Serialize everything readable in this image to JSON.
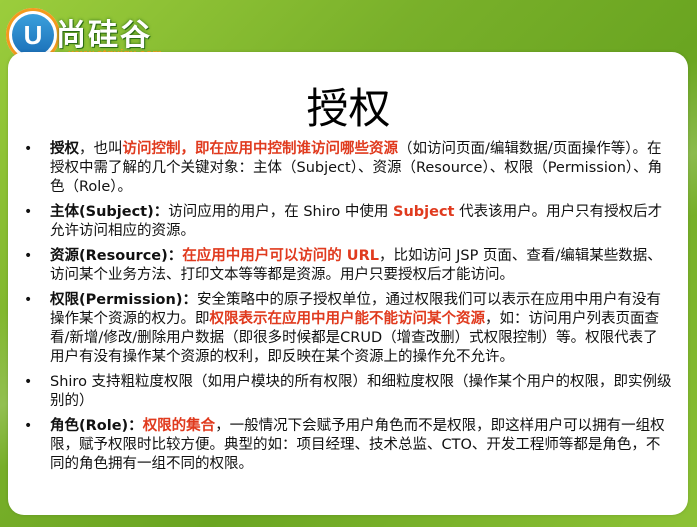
{
  "brand": {
    "name": "尚硅谷",
    "url": "www.atguigu.com",
    "badge_letter": "U"
  },
  "slide": {
    "title": "授权",
    "bullets": [
      [
        {
          "t": "授权",
          "s": "b"
        },
        {
          "t": "，也叫",
          "s": ""
        },
        {
          "t": "访问控制，即在应用中控制谁访问哪些资源",
          "s": "r"
        },
        {
          "t": "（如访问页面/编辑数据/页面操作等）。在授权中需了解的几个关键对象：主体（Subject）、资源（Resource）、权限（Permission）、角色（Role）。",
          "s": ""
        }
      ],
      [
        {
          "t": "主体(Subject)：",
          "s": "b"
        },
        {
          "t": "访问应用的用户，在 Shiro 中使用 ",
          "s": ""
        },
        {
          "t": "Subject",
          "s": "r"
        },
        {
          "t": " 代表该用户。用户只有授权后才允许访问相应的资源。",
          "s": ""
        }
      ],
      [
        {
          "t": "资源(Resource)：",
          "s": "b"
        },
        {
          "t": "在应用中用户可以访问的 URL",
          "s": "r"
        },
        {
          "t": "，比如访问 JSP 页面、查看/编辑某些数据、访问某个业务方法、打印文本等等都是资源。用户只要授权后才能访问。",
          "s": ""
        }
      ],
      [
        {
          "t": "权限(Permission)：",
          "s": "b"
        },
        {
          "t": "安全策略中的原子授权单位，通过权限我们可以表示在应用中用户有没有操作某个资源的权力。即",
          "s": ""
        },
        {
          "t": "权限表示在应用中用户能不能访问某个资源",
          "s": "r"
        },
        {
          "t": "，如：访问用户列表页面查看/新增/修改/删除用户数据（即很多时候都是CRUD（增查改删）式权限控制）等。权限代表了用户有没有操作某个资源的权利，即反映在某个资源上的操作允不允许。",
          "s": ""
        }
      ],
      [
        {
          "t": "Shiro 支持粗粒度权限（如用户模块的所有权限）和细粒度权限（操作某个用户的权限，即实例级别的）",
          "s": ""
        }
      ],
      [
        {
          "t": "角色(Role)：",
          "s": "b"
        },
        {
          "t": "权限的集合",
          "s": "r"
        },
        {
          "t": "，一般情况下会赋予用户角色而不是权限，即这样用户可以拥有一组权限，赋予权限时比较方便。典型的如：项目经理、技术总监、CTO、开发工程师等都是角色，不同的角色拥有一组不同的权限。",
          "s": ""
        }
      ]
    ]
  },
  "colors": {
    "accent": "#e03a1e",
    "frame_green": "#7fb32a",
    "logo_orange": "#f39a1e"
  }
}
